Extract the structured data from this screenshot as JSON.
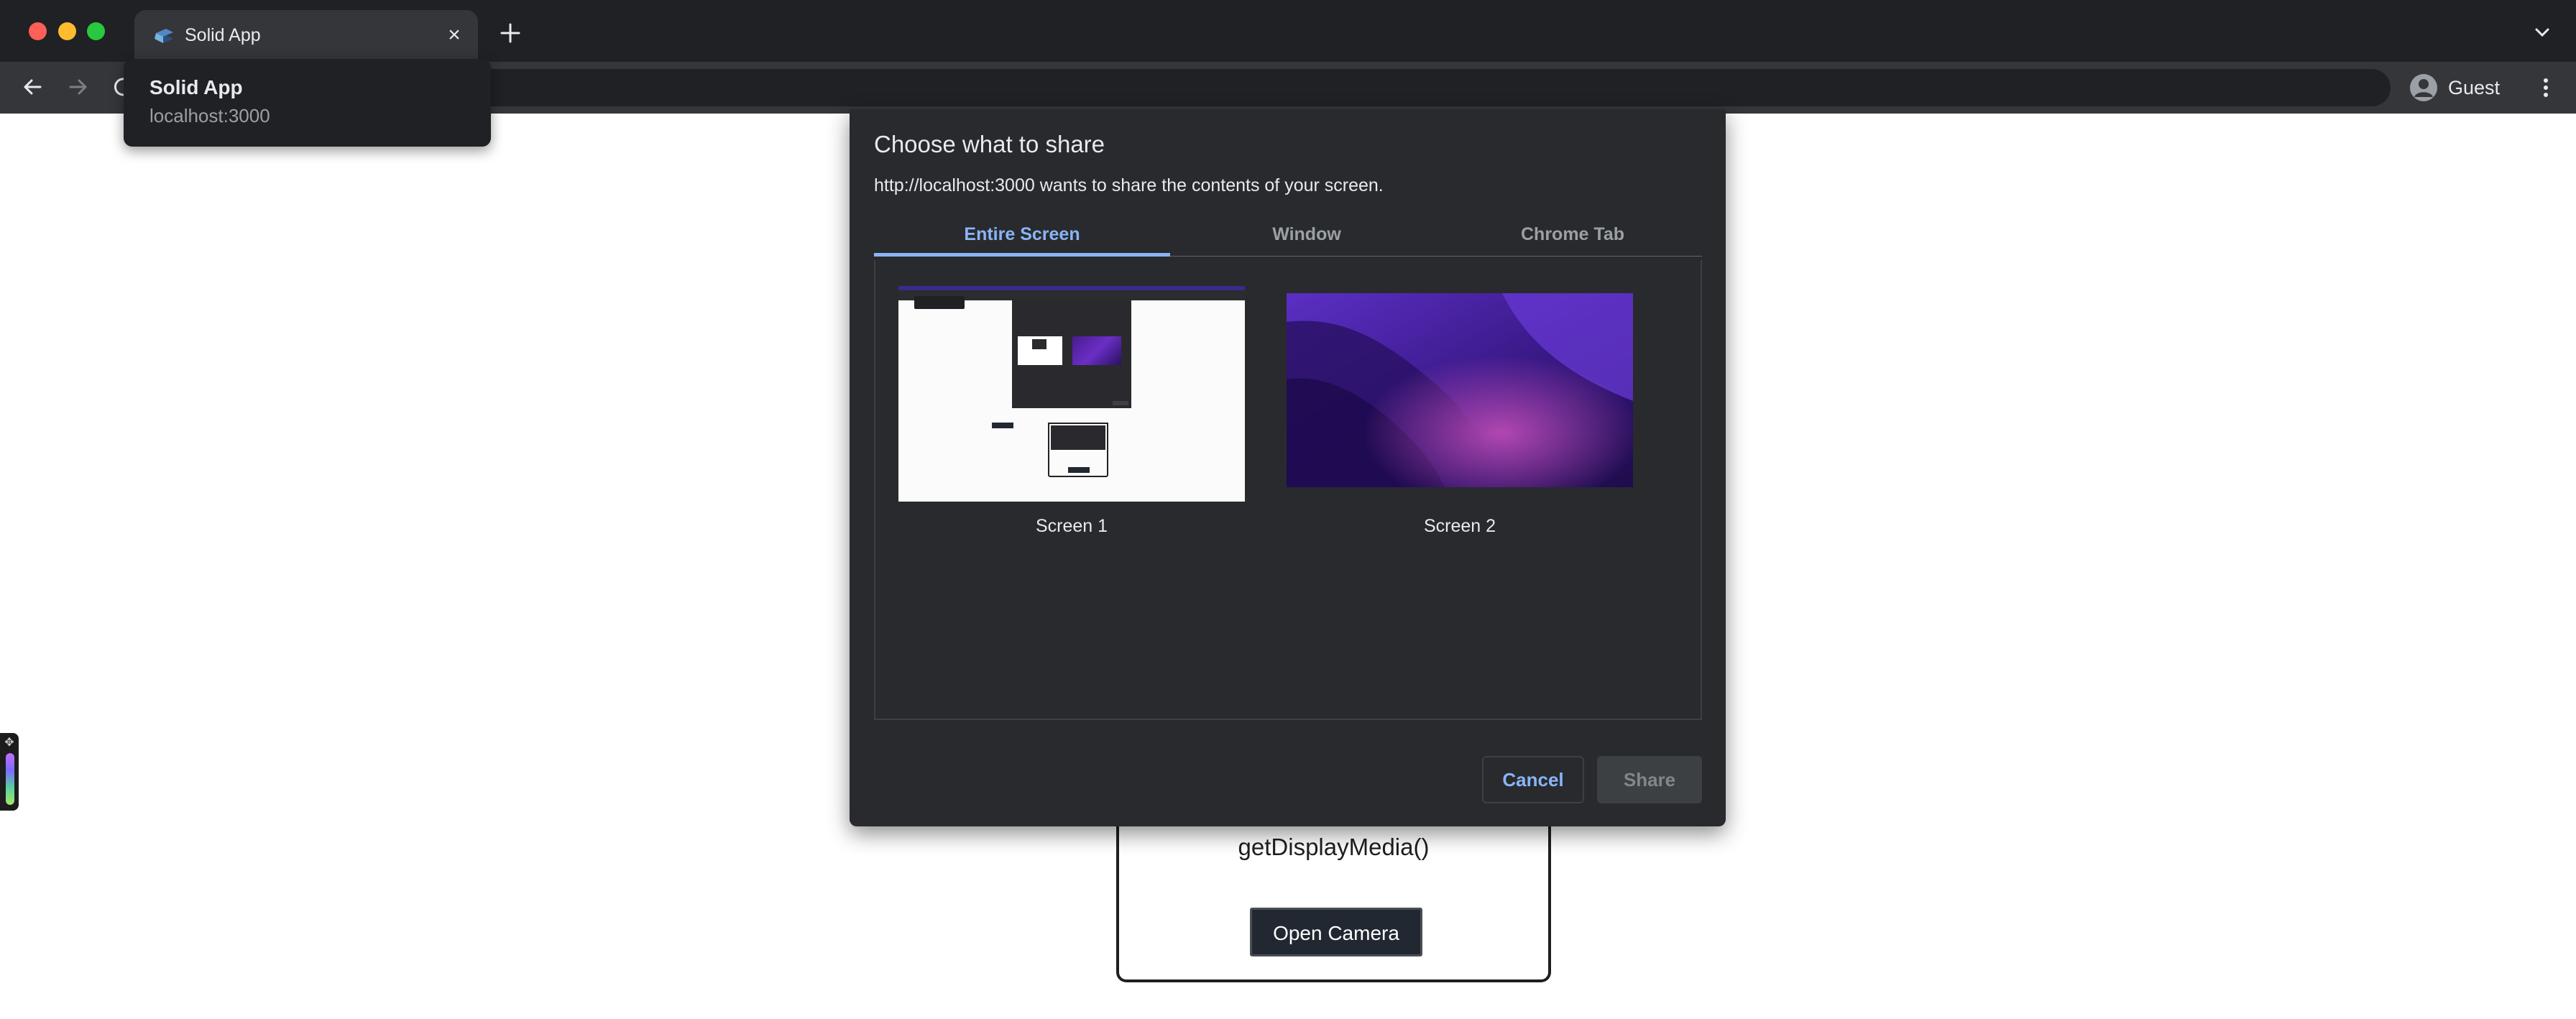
{
  "browser": {
    "tab": {
      "title": "Solid App"
    },
    "hovercard": {
      "title": "Solid App",
      "url": "localhost:3000"
    },
    "profile": {
      "name": "Guest"
    }
  },
  "dialog": {
    "title": "Choose what to share",
    "subtitle": "http://localhost:3000 wants to share the contents of your screen.",
    "tabs": [
      {
        "label": "Entire Screen",
        "selected": true
      },
      {
        "label": "Window",
        "selected": false
      },
      {
        "label": "Chrome Tab",
        "selected": false
      }
    ],
    "screens": [
      {
        "label": "Screen 1"
      },
      {
        "label": "Screen 2"
      }
    ],
    "cancel_label": "Cancel",
    "share_label": "Share",
    "share_enabled": false
  },
  "page": {
    "function_text": "getDisplayMedia()",
    "button_label": "Open Camera"
  },
  "colors": {
    "accent": "#8ab4f8",
    "dialog_bg": "#292a2d",
    "chrome_bg": "#202124"
  }
}
